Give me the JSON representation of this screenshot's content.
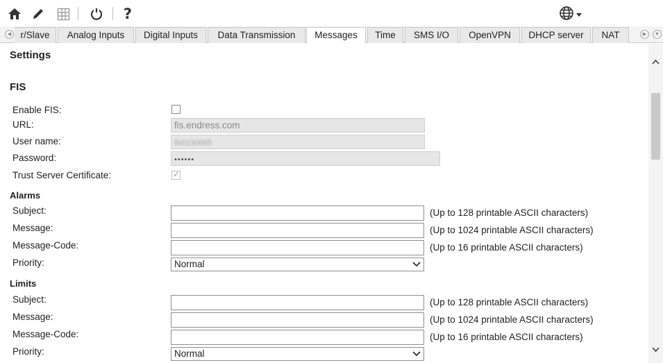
{
  "toolbar": {
    "icons": [
      "home-icon",
      "pencil-icon",
      "grid-icon",
      "refresh-icon",
      "help-icon",
      "globe-icon",
      "chevron-down-icon"
    ],
    "help_label": "?"
  },
  "tabs": [
    {
      "label": "r/Slave"
    },
    {
      "label": "Analog Inputs"
    },
    {
      "label": "Digital Inputs"
    },
    {
      "label": "Data Transmission"
    },
    {
      "label": "Messages",
      "active": true
    },
    {
      "label": "Time"
    },
    {
      "label": "SMS I/O"
    },
    {
      "label": "OpenVPN"
    },
    {
      "label": "DHCP server"
    },
    {
      "label": "NAT"
    }
  ],
  "settings_title": "Settings",
  "fis": {
    "title": "FIS",
    "enable_label": "Enable FIS:",
    "enable_checked": false,
    "url_label": "URL:",
    "url_value": "fis.endress.com",
    "username_label": "User name:",
    "username_value": "fis0230665",
    "password_label": "Password:",
    "password_value": "••••••",
    "trust_label": "Trust Server Certificate:",
    "trust_checked": true
  },
  "alarms": {
    "title": "Alarms",
    "subject_label": "Subject:",
    "subject_hint": "(Up to 128 printable ASCII characters)",
    "message_label": "Message:",
    "message_hint": "(Up to 1024 printable ASCII characters)",
    "code_label": "Message-Code:",
    "code_hint": "(Up to 16 printable ASCII characters)",
    "priority_label": "Priority:",
    "priority_value": "Normal"
  },
  "limits": {
    "title": "Limits",
    "subject_label": "Subject:",
    "subject_hint": "(Up to 128 printable ASCII characters)",
    "message_label": "Message:",
    "message_hint": "(Up to 1024 printable ASCII characters)",
    "code_label": "Message-Code:",
    "code_hint": "(Up to 16 printable ASCII characters)",
    "priority_label": "Priority:",
    "priority_value": "Normal"
  },
  "colors": {
    "tab_active_bg": "#ffffff",
    "tab_bg": "#e9e9e9",
    "readonly_bg": "#e6e6e6",
    "scroll_thumb": "#c9c9c9"
  }
}
